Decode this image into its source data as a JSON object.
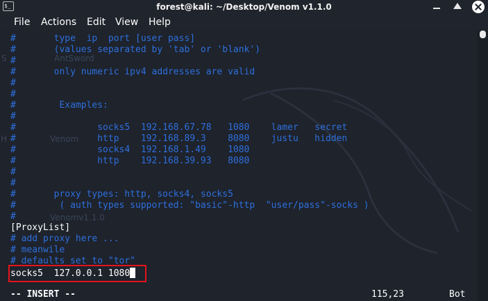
{
  "window": {
    "title": "forest@kali: ~/Desktop/Venom v1.1.0",
    "app_icon_glyph": "$_",
    "buttons": [
      "minimize",
      "maximize",
      "close"
    ]
  },
  "menu": [
    "File",
    "Actions",
    "Edit",
    "View",
    "Help"
  ],
  "background_ghost_text": {
    "s": "S",
    "antsword": "AntSword",
    "venom": "Venom",
    "h": "H",
    "venom_v": "Venomv1.1.0"
  },
  "editor": {
    "lines": [
      "#       type  ip  port [user pass]",
      "#       (values separated by 'tab' or 'blank')",
      "#",
      "#       only numeric ipv4 addresses are valid",
      "#",
      "#",
      "#        Examples:",
      "#",
      "#               socks5  192.168.67.78   1080    lamer   secret",
      "#               http    192.168.89.3    8080    justu   hidden",
      "#               socks4  192.168.1.49    1080",
      "#               http    192.168.39.93   8080",
      "#",
      "#",
      "#       proxy types: http, socks4, socks5",
      "#        ( auth types supported: \"basic\"-http  \"user/pass\"-socks )",
      "#",
      "[ProxyList]",
      "# add proxy here ...",
      "# meanwile",
      "# defaults set to \"tor\"",
      "socks5  127.0.0.1 1080"
    ],
    "line_kinds": [
      "comment",
      "comment",
      "comment",
      "comment",
      "comment",
      "comment",
      "comment",
      "comment",
      "comment",
      "comment",
      "comment",
      "comment",
      "comment",
      "comment",
      "comment",
      "comment",
      "comment",
      "plain",
      "comment",
      "comment",
      "comment",
      "plain"
    ],
    "status_mode": "-- INSERT --",
    "cursor_position": "115,23",
    "scroll_position": "Bot"
  },
  "colors": {
    "comment": "#2f6fdc",
    "text": "#ffffff",
    "background": "#1e232c",
    "highlight": "#e5131b"
  }
}
